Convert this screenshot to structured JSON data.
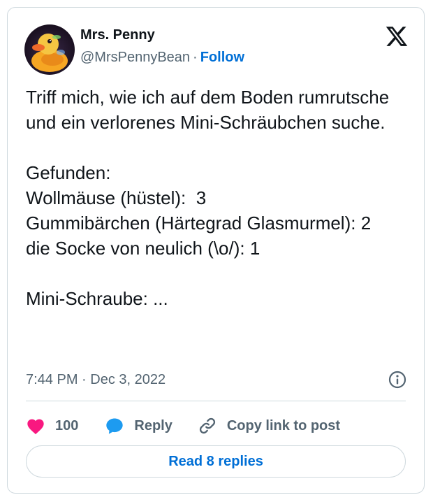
{
  "header": {
    "display_name": "Mrs. Penny",
    "handle": "@MrsPennyBean",
    "separator": "·",
    "follow_label": "Follow",
    "avatar_icon": "rubber-duck-avatar",
    "logo_icon": "x-logo-icon"
  },
  "tweet": {
    "text": "Triff mich, wie ich auf dem Boden rumrutsche und ein verlorenes Mini-Schräubchen suche.\n\nGefunden:\nWollmäuse (hüstel):  3\nGummibärchen (Härtegrad Glasmurmel): 2\ndie Socke von neulich (\\o/): 1\n\nMini-Schraube: ...",
    "timestamp": "7:44 PM · Dec 3, 2022"
  },
  "actions": {
    "like_count": "100",
    "reply_label": "Reply",
    "copy_link_label": "Copy link to post"
  },
  "footer": {
    "read_replies_label": "Read 8 replies"
  },
  "colors": {
    "like": "#f91880",
    "reply": "#1d9bf0",
    "link": "#006fd6",
    "muted": "#536471"
  }
}
